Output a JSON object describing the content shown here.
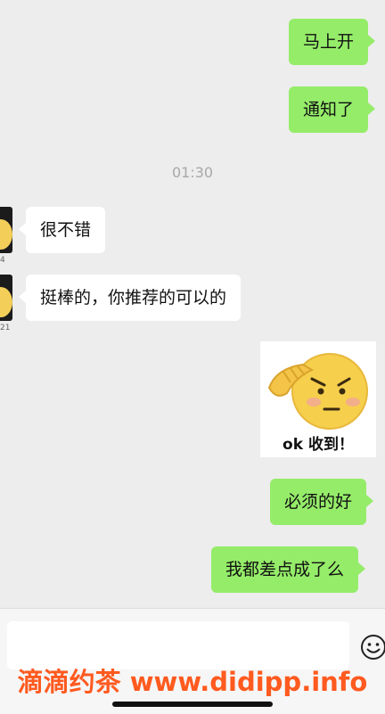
{
  "messages": [
    {
      "id": "m1",
      "side": "out",
      "text": "马上开"
    },
    {
      "id": "m2",
      "side": "out",
      "text": "通知了"
    },
    {
      "id": "m3",
      "side": "in",
      "text": "很不错",
      "avatar_badge": "4"
    },
    {
      "id": "m4",
      "side": "in",
      "text": "挺棒的，你推荐的可以的",
      "avatar_badge": "21"
    },
    {
      "id": "m5",
      "side": "out",
      "type": "sticker",
      "sticker_text": "ok 收到！",
      "sticker_icon": "salute-emoji-icon"
    },
    {
      "id": "m6",
      "side": "out",
      "text": "必须的好"
    },
    {
      "id": "m7",
      "side": "out",
      "text": "我都差点成了么"
    }
  ],
  "timestamp": "01:30",
  "input": {
    "value": "",
    "emoji_icon": "smiley-face-icon"
  },
  "watermark": "滴滴约茶 www.didipp.info",
  "colors": {
    "outgoing_bubble": "#95ec69",
    "incoming_bubble": "#ffffff",
    "background": "#ededed",
    "watermark": "#ff5a1f"
  }
}
